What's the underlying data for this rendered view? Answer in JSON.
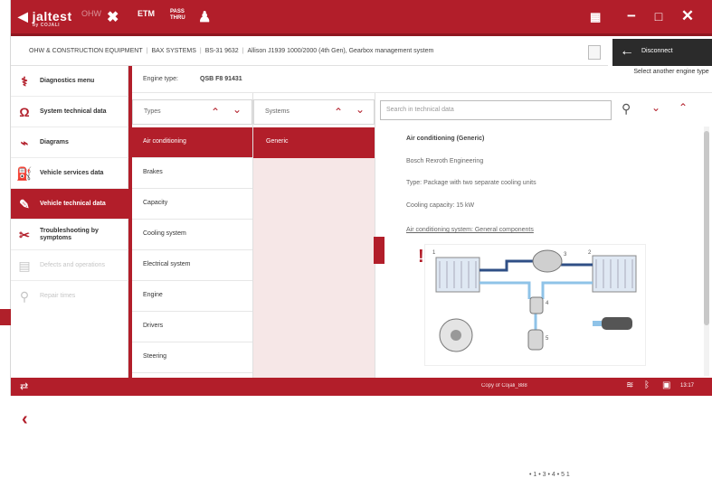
{
  "topbar": {
    "logo": "jaltest",
    "logo_sub": "by COJALI",
    "tool_dim": "OHW",
    "tool_etm": "ETM",
    "tool_pass": "PASS THRU",
    "colors": {
      "brand": "#b21e2a",
      "dark": "#2b2b2b"
    }
  },
  "breadcrumb": {
    "items": [
      "OHW & CONSTRUCTION EQUIPMENT",
      "BAX SYSTEMS",
      "BS-31 9632",
      "Allison J1939 1000/2000 (4th Gen), Gearbox management system"
    ]
  },
  "disconnect": {
    "label": "Disconnect"
  },
  "menu": {
    "items": [
      {
        "label": "Diagnostics menu"
      },
      {
        "label": "System technical data"
      },
      {
        "label": "Diagrams"
      },
      {
        "label": "Vehicle services data"
      },
      {
        "label": "Vehicle technical data"
      },
      {
        "label": "Troubleshooting by symptoms"
      },
      {
        "label": "Defects and operations"
      },
      {
        "label": "Repair times"
      }
    ]
  },
  "engine": {
    "label": "Engine type:",
    "value": "QSB F8 91431"
  },
  "select_engine": "Select another engine type",
  "columns": {
    "types_header": "Types",
    "systems_header": "Systems"
  },
  "types": [
    "Air conditioning",
    "Brakes",
    "Capacity",
    "Cooling system",
    "Electrical system",
    "Engine",
    "Drivers",
    "Steering"
  ],
  "systems": [
    "Generic"
  ],
  "search": {
    "placeholder": "Search in technical data"
  },
  "content": {
    "title": "Air conditioning (Generic)",
    "manufacturer": "Bosch Rexroth Engineering",
    "type": "Type: Package with two separate cooling units",
    "capacity": "Cooling capacity: 15 kW",
    "link": "Air conditioning system: General components",
    "dots": "• 1   • 3   • 4   • 5   1"
  },
  "footer": {
    "customer": "Copy of Cojali_888",
    "time": "13:17"
  }
}
